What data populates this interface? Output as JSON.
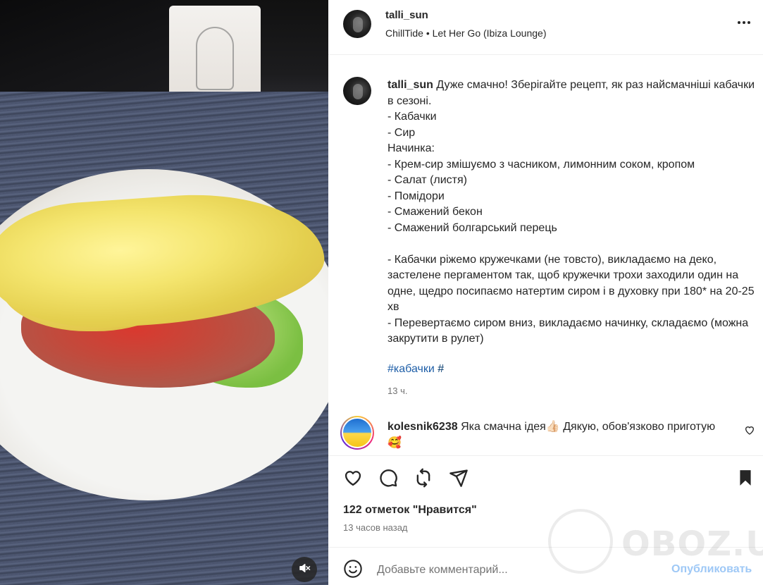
{
  "post": {
    "username": "talli_sun",
    "music": "ChillTide • Let Her Go (Ibiza Lounge)"
  },
  "caption": {
    "username": "talli_sun",
    "text": " Дуже смачно! Зберігайте рецепт, як раз найсмачніші кабачки в сезоні.\n- Кабачки\n- Сир\nНачинка:\n- Крем-сир змішуємо з часником, лимонним соком, кропом\n- Салат (листя)\n- Помідори\n- Смажений бекон\n- Смажений болгарський перець\n\n- Кабачки ріжемо кружечками (не товсто), викладаємо на деко, застелене пергаментом так, щоб кружечки трохи заходили один на одне, щедро посипаємо натертим сиром і в духовку при 180* на 20-25 хв\n- Перевертаємо сиром вниз, викладаємо начинку, складаємо (можна закрутити в рулет)",
    "hashtag": "#кабачки",
    "hashtag_rest": " #",
    "time": "13 ч."
  },
  "comment": {
    "username": "kolesnik6238",
    "text": " Яка смачна ідея👍🏻 Дякую, обов'язково приготую 🥰"
  },
  "actions": {
    "likes": "122 отметок \"Нравится\"",
    "ago": "13 часов назад"
  },
  "add_comment": {
    "placeholder": "Добавьте комментарий...",
    "post_label": "Опубликовать"
  },
  "watermark": {
    "text": "OBOZ.UA"
  },
  "icons": [
    "more-icon",
    "heart-icon",
    "comment-icon",
    "share-icon",
    "send-icon",
    "bookmark-icon",
    "emoji-icon",
    "mute-icon",
    "globe-icon"
  ]
}
